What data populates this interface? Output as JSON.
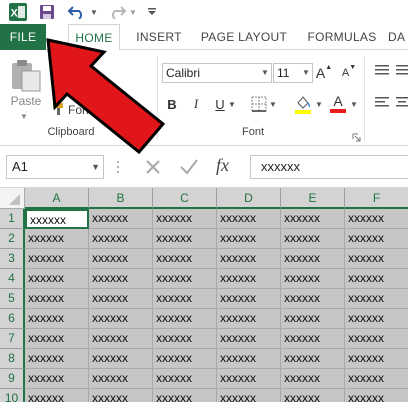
{
  "ribbon_tabs": [
    {
      "label": "FILE"
    },
    {
      "label": "HOME"
    },
    {
      "label": "INSERT"
    },
    {
      "label": "PAGE LAYOUT"
    },
    {
      "label": "FORMULAS"
    },
    {
      "label": "DA"
    }
  ],
  "clipboard": {
    "paste_label": "Paste",
    "copy_label": "Co",
    "format_label": "Format",
    "format_label_tail": "r",
    "group_label": "Clipboard"
  },
  "font": {
    "family": "Calibri",
    "size": "11",
    "bold": "B",
    "italic": "I",
    "underline": "U",
    "grow": "A",
    "shrink": "A",
    "font_color_glyph": "A",
    "group_label": "Font"
  },
  "formula_bar": {
    "name_box": "A1",
    "fx_label": "fx",
    "value": "xxxxxx"
  },
  "grid": {
    "columns": [
      "A",
      "B",
      "C",
      "D",
      "E",
      "F"
    ],
    "rows": [
      "1",
      "2",
      "3",
      "4",
      "5",
      "6",
      "7",
      "8",
      "9",
      "10"
    ],
    "cell_value": "xxxxxx"
  },
  "colors": {
    "excel_green": "#217346",
    "arrow_red": "#e1161a",
    "selection_gray": "#c6c6c6"
  }
}
